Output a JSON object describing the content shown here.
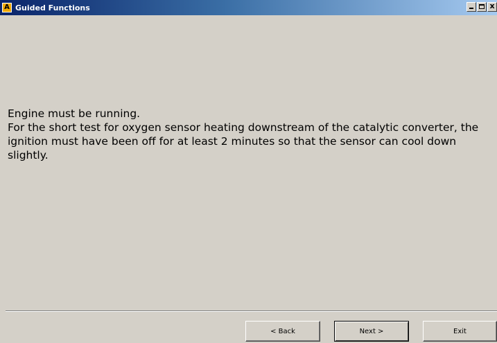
{
  "window": {
    "title": "Guided Functions",
    "icon_letter": "A",
    "controls": {
      "minimize": "minimize-icon",
      "maximize": "maximize-icon",
      "close_glyph": "x"
    }
  },
  "instructions": {
    "line1": "Engine must be running.",
    "line2": "For the short test for oxygen sensor heating downstream of the catalytic converter, the ignition must have been off for at least 2 minutes so that the sensor can cool down slightly."
  },
  "buttons": {
    "back": "< Back",
    "next": "Next >",
    "exit": "Exit"
  },
  "colors": {
    "background": "#d4d0c8",
    "titlebar_start": "#0a246a",
    "titlebar_end": "#a6caf0",
    "app_icon": "#f0a800"
  }
}
